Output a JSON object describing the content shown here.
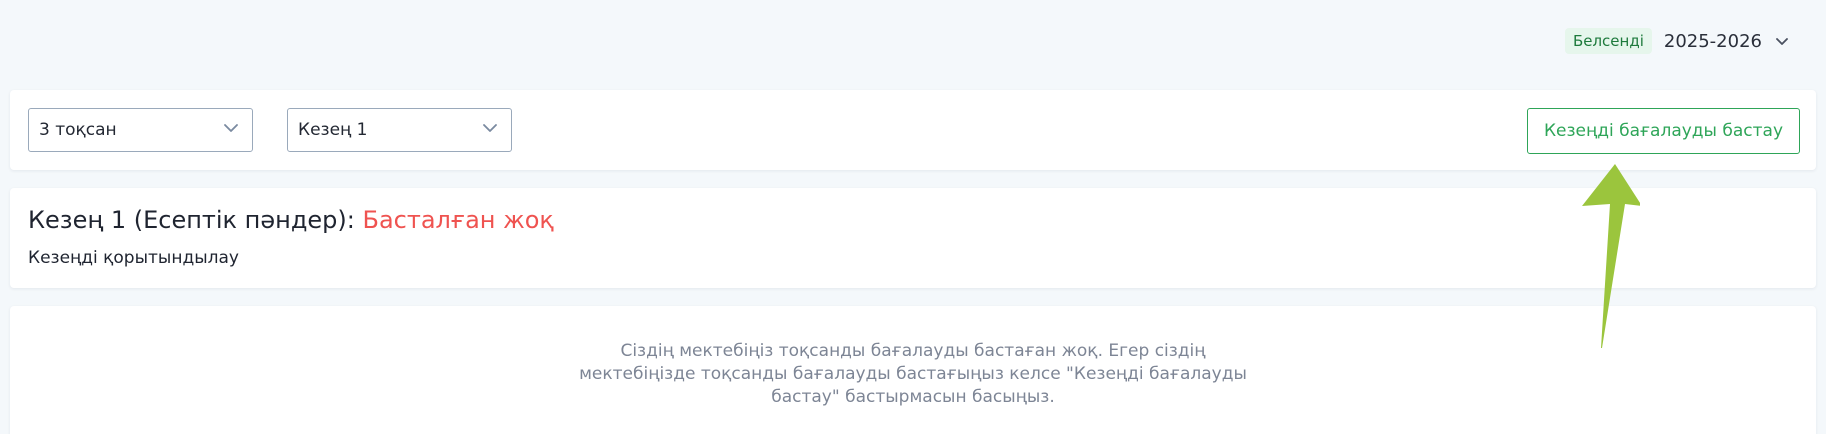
{
  "header": {
    "status_badge": "Белсенді",
    "year": "2025-2026"
  },
  "filters": {
    "quarter": "3 тоқсан",
    "period": "Кезең 1",
    "start_button": "Кезеңді бағалауды бастау"
  },
  "period_card": {
    "title": "Кезең 1 (Есептік пәндер):",
    "status": "Басталған жоқ",
    "summary_link": "Кезеңді қорытындылау"
  },
  "info": {
    "message": "Сіздің мектебіңіз тоқсанды бағалауды бастаған жоқ. Егер сіздің мектебіңізде тоқсанды бағалауды бастағыңыз келсе \"Кезеңді бағалауды бастау\" бастырмасын басыңыз."
  },
  "colors": {
    "accent_green": "#2ea558",
    "status_red": "#ef5350",
    "annotation_arrow": "#9bc53d"
  }
}
